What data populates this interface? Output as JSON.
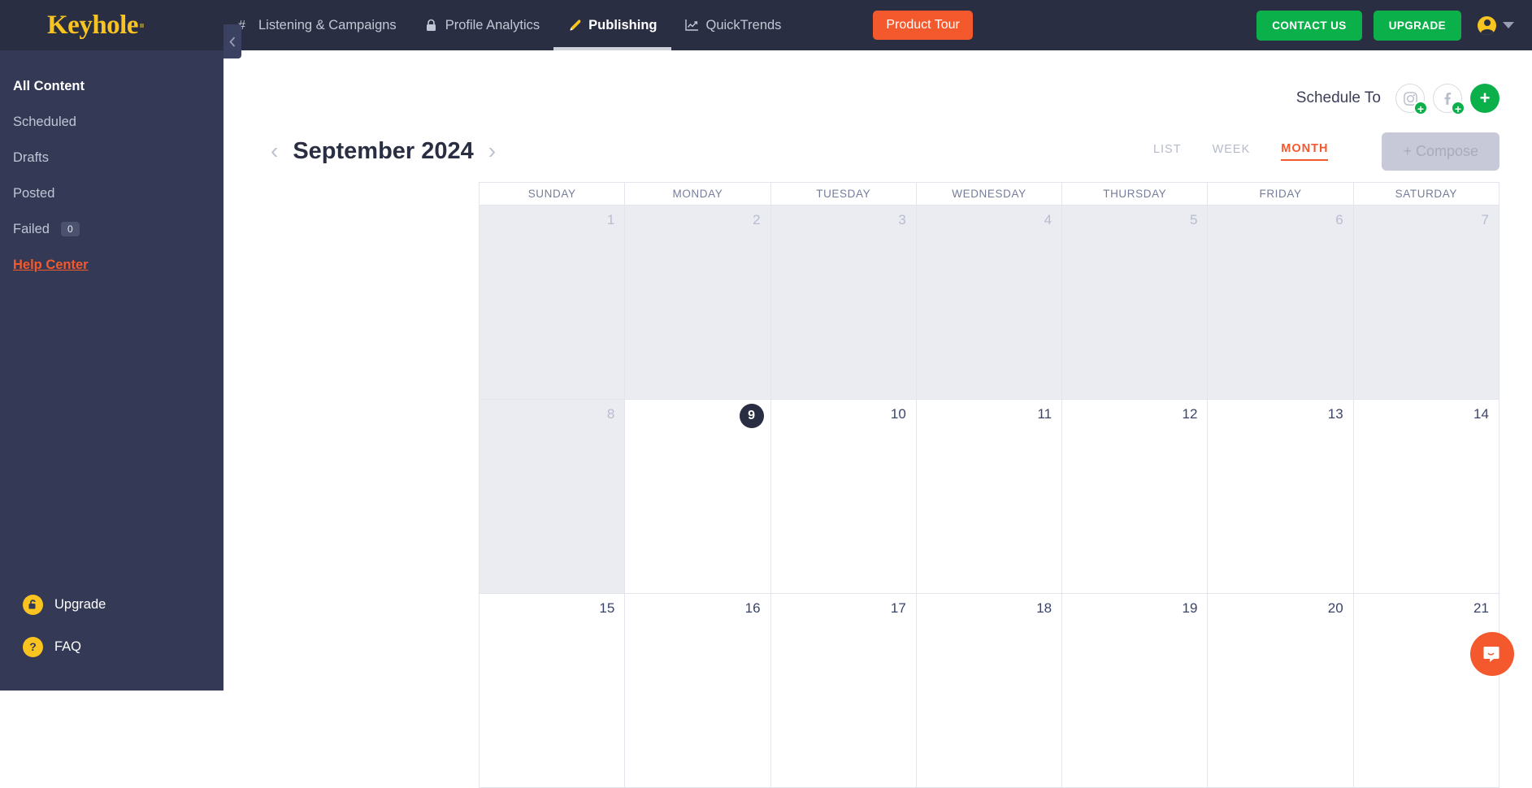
{
  "brand": {
    "name": "Keyhole"
  },
  "topnav": {
    "items": [
      {
        "label": "Listening & Campaigns",
        "icon": "hash-icon",
        "active": false
      },
      {
        "label": "Profile Analytics",
        "icon": "lock-icon",
        "active": false
      },
      {
        "label": "Publishing",
        "icon": "pen-icon",
        "active": true
      },
      {
        "label": "QuickTrends",
        "icon": "trend-chart-icon",
        "active": false
      }
    ],
    "product_tour_label": "Product Tour",
    "contact_label": "CONTACT US",
    "upgrade_label": "UPGRADE",
    "colors": {
      "product_tour": "#F4592D",
      "green": "#0CB04A",
      "bar": "#2A2E43"
    }
  },
  "sidebar": {
    "items": [
      {
        "label": "All Content",
        "active": true
      },
      {
        "label": "Scheduled",
        "active": false
      },
      {
        "label": "Drafts",
        "active": false
      },
      {
        "label": "Posted",
        "active": false
      },
      {
        "label": "Failed",
        "active": false,
        "badge": "0"
      }
    ],
    "help_center_label": "Help Center",
    "bottom": [
      {
        "label": "Upgrade",
        "icon": "unlock-icon"
      },
      {
        "label": "FAQ",
        "icon": "question-mark-icon"
      }
    ]
  },
  "schedule": {
    "label": "Schedule To",
    "accounts": [
      {
        "network": "instagram",
        "icon": "instagram-icon"
      },
      {
        "network": "facebook",
        "icon": "facebook-icon"
      }
    ],
    "add_label": "+"
  },
  "calendar": {
    "month_title": "September 2024",
    "prev_label": "‹",
    "next_label": "›",
    "views": [
      {
        "label": "LIST",
        "active": false
      },
      {
        "label": "WEEK",
        "active": false
      },
      {
        "label": "MONTH",
        "active": true
      }
    ],
    "compose_label": "+ Compose",
    "compose_disabled": true,
    "weekdays": [
      "SUNDAY",
      "MONDAY",
      "TUESDAY",
      "WEDNESDAY",
      "THURSDAY",
      "FRIDAY",
      "SATURDAY"
    ],
    "today": 9,
    "weeks": [
      [
        {
          "day": "1",
          "past": true
        },
        {
          "day": "2",
          "past": true
        },
        {
          "day": "3",
          "past": true
        },
        {
          "day": "4",
          "past": true
        },
        {
          "day": "5",
          "past": true
        },
        {
          "day": "6",
          "past": true
        },
        {
          "day": "7",
          "past": true
        }
      ],
      [
        {
          "day": "8",
          "past": true
        },
        {
          "day": "9",
          "past": false,
          "today": true
        },
        {
          "day": "10",
          "past": false
        },
        {
          "day": "11",
          "past": false
        },
        {
          "day": "12",
          "past": false
        },
        {
          "day": "13",
          "past": false
        },
        {
          "day": "14",
          "past": false
        }
      ],
      [
        {
          "day": "15",
          "past": false
        },
        {
          "day": "16",
          "past": false
        },
        {
          "day": "17",
          "past": false
        },
        {
          "day": "18",
          "past": false
        },
        {
          "day": "19",
          "past": false
        },
        {
          "day": "20",
          "past": false
        },
        {
          "day": "21",
          "past": false
        }
      ]
    ]
  },
  "chat_widget": {
    "icon": "intercom-chat-icon",
    "color": "#F4592D"
  }
}
